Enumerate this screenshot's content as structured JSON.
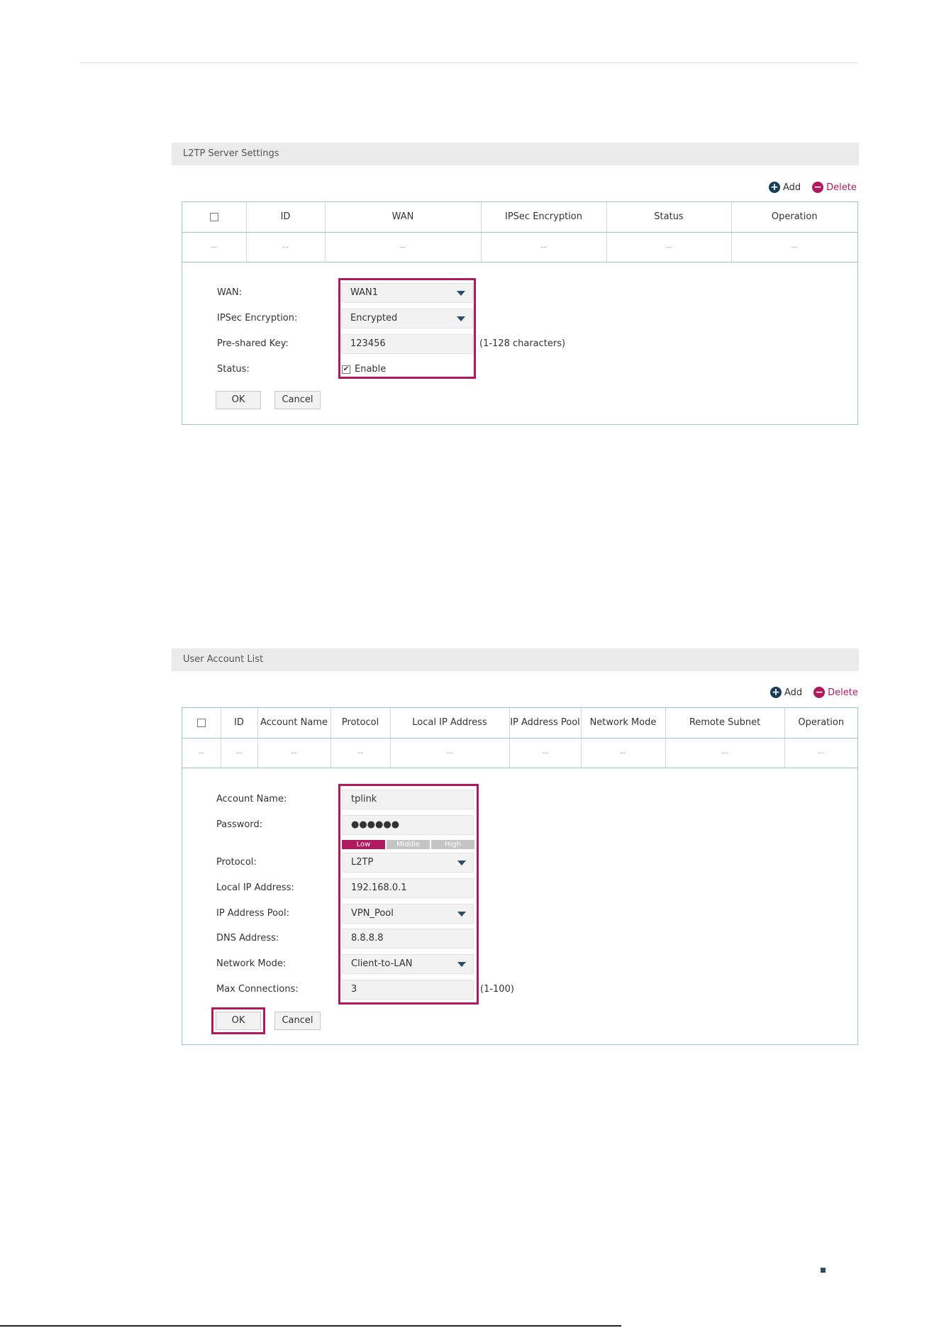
{
  "section1": {
    "title": "L2TP Server Settings",
    "add_label": "Add",
    "delete_label": "Delete",
    "columns": [
      "ID",
      "WAN",
      "IPSec Encryption",
      "Status",
      "Operation"
    ],
    "empty_cell": "--",
    "form": {
      "wan_label": "WAN:",
      "wan_value": "WAN1",
      "ipsec_label": "IPSec Encryption:",
      "ipsec_value": "Encrypted",
      "psk_label": "Pre-shared Key:",
      "psk_value": "123456",
      "psk_hint": "(1-128 characters)",
      "status_label": "Status:",
      "status_checkbox_label": "Enable",
      "status_checked": true
    },
    "ok_label": "OK",
    "cancel_label": "Cancel"
  },
  "section2": {
    "title": "User Account List",
    "add_label": "Add",
    "delete_label": "Delete",
    "columns": [
      "ID",
      "Account Name",
      "Protocol",
      "Local IP Address",
      "IP Address Pool",
      "Network Mode",
      "Remote Subnet",
      "Operation"
    ],
    "empty_cell": "--",
    "form": {
      "account_label": "Account Name:",
      "account_value": "tplink",
      "password_label": "Password:",
      "password_value": "●●●●●●",
      "strength_low": "Low",
      "strength_middle": "Middle",
      "strength_high": "High",
      "protocol_label": "Protocol:",
      "protocol_value": "L2TP",
      "local_ip_label": "Local IP Address:",
      "local_ip_value": "192.168.0.1",
      "pool_label": "IP Address Pool:",
      "pool_value": "VPN_Pool",
      "dns_label": "DNS Address:",
      "dns_value": "8.8.8.8",
      "mode_label": "Network Mode:",
      "mode_value": "Client-to-LAN",
      "max_label": "Max Connections:",
      "max_value": "3",
      "max_hint": "(1-100)"
    },
    "ok_label": "OK",
    "cancel_label": "Cancel"
  },
  "colors": {
    "highlight": "#b0195e",
    "accent_dark": "#173c55",
    "panel_border": "#9ec4dc"
  }
}
